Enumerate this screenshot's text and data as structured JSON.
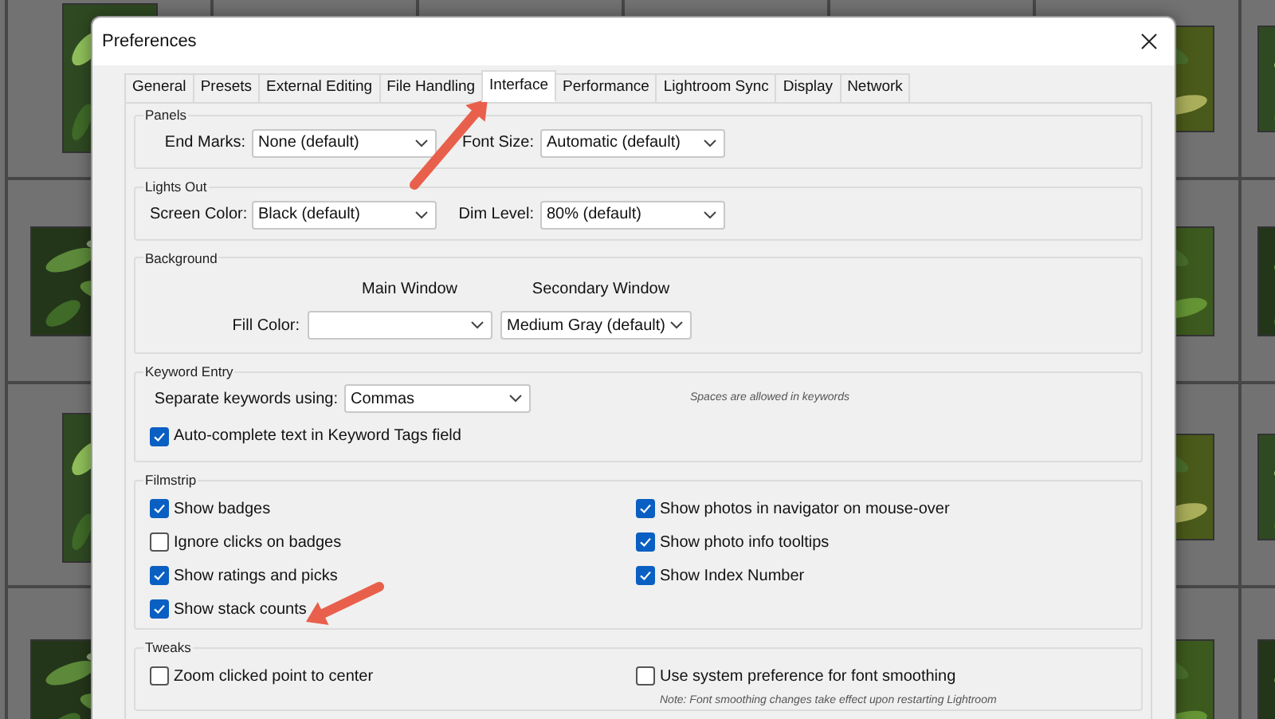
{
  "window": {
    "title": "Preferences"
  },
  "tabs": [
    {
      "label": "General",
      "selected": false
    },
    {
      "label": "Presets",
      "selected": false
    },
    {
      "label": "External Editing",
      "selected": false
    },
    {
      "label": "File Handling",
      "selected": false
    },
    {
      "label": "Interface",
      "selected": true
    },
    {
      "label": "Performance",
      "selected": false
    },
    {
      "label": "Lightroom Sync",
      "selected": false
    },
    {
      "label": "Display",
      "selected": false
    },
    {
      "label": "Network",
      "selected": false
    }
  ],
  "panels": {
    "title": "Panels",
    "fields": [
      {
        "label": "End Marks:",
        "value": "None (default)"
      },
      {
        "label": "Font Size:",
        "value": "Automatic (default)"
      }
    ]
  },
  "lights_out": {
    "title": "Lights Out",
    "fields": [
      {
        "label": "Screen Color:",
        "value": "Black (default)"
      },
      {
        "label": "Dim Level:",
        "value": "80% (default)"
      }
    ]
  },
  "background": {
    "title": "Background",
    "columns": [
      "Main Window",
      "Secondary Window"
    ],
    "label": "Fill Color:",
    "secondary_value": "Medium Gray (default)"
  },
  "keyword_entry": {
    "title": "Keyword Entry",
    "label": "Separate keywords using:",
    "value": "Commas",
    "note": "Spaces are allowed in keywords",
    "checkbox": {
      "label": "Auto-complete text in Keyword Tags field",
      "checked": true
    }
  },
  "filmstrip": {
    "title": "Filmstrip",
    "left": [
      {
        "label": "Show badges",
        "checked": true
      },
      {
        "label": "Ignore clicks on badges",
        "checked": false
      },
      {
        "label": "Show ratings and picks",
        "checked": true
      },
      {
        "label": "Show stack counts",
        "checked": true
      }
    ],
    "right": [
      {
        "label": "Show photos in navigator on mouse-over",
        "checked": true
      },
      {
        "label": "Show photo info tooltips",
        "checked": true
      },
      {
        "label": "Show Index Number",
        "checked": true
      }
    ]
  },
  "tweaks": {
    "title": "Tweaks",
    "left": [
      {
        "label": "Zoom clicked point to center",
        "checked": false
      }
    ],
    "right": [
      {
        "label": "Use system preference for font smoothing",
        "checked": false
      }
    ],
    "note": "Note: Font smoothing changes take effect upon restarting Lightroom"
  }
}
